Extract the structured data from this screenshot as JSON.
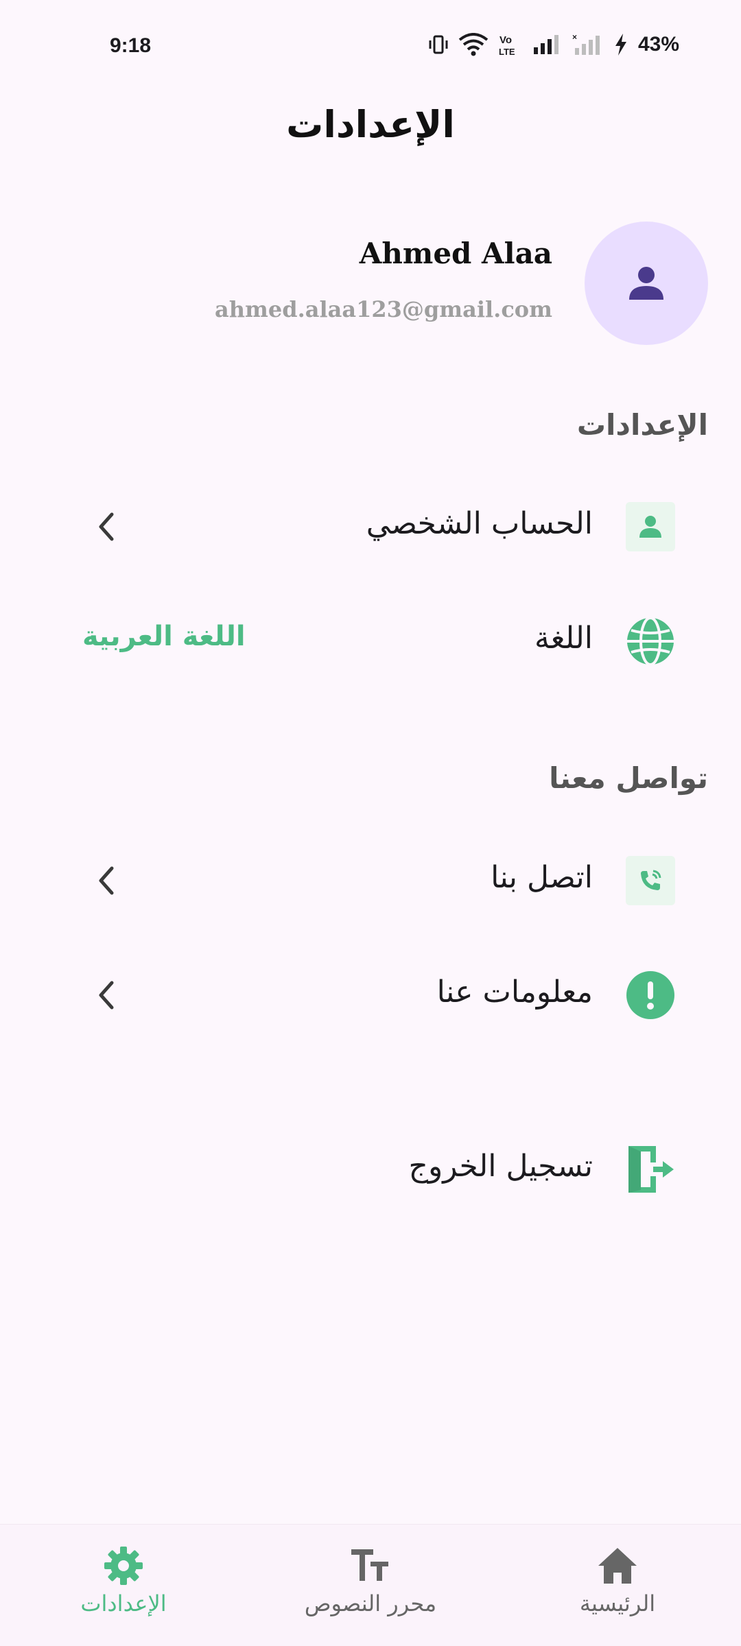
{
  "status_bar": {
    "time": "9:18",
    "battery": "43%"
  },
  "header": {
    "title": "الإعدادات"
  },
  "profile": {
    "name": "Ahmed Alaa",
    "email": "ahmed.alaa123@gmail.com",
    "avatar_icon": "person-icon"
  },
  "settings_section": {
    "title": "الإعدادات",
    "items": [
      {
        "label": "الحساب الشخصي",
        "icon": "person-icon"
      },
      {
        "label": "اللغة",
        "icon": "globe-icon",
        "value": "اللغة العربية"
      }
    ]
  },
  "contact_section": {
    "title": "تواصل معنا",
    "items": [
      {
        "label": "اتصل بنا",
        "icon": "phone-icon"
      },
      {
        "label": "معلومات عنا",
        "icon": "info-icon"
      }
    ]
  },
  "logout": {
    "label": "تسجيل الخروج",
    "icon": "logout-icon"
  },
  "bottom_nav": {
    "items": [
      {
        "label": "الإعدادات",
        "icon": "gear-icon",
        "active": true
      },
      {
        "label": "محرر النصوص",
        "icon": "text-size-icon",
        "active": false
      },
      {
        "label": "الرئيسية",
        "icon": "home-icon",
        "active": false
      }
    ]
  },
  "colors": {
    "accent": "#4dbb85",
    "avatar_bg": "#e9ddff",
    "avatar_icon": "#4a3a8c",
    "background": "#fdf7fd"
  }
}
